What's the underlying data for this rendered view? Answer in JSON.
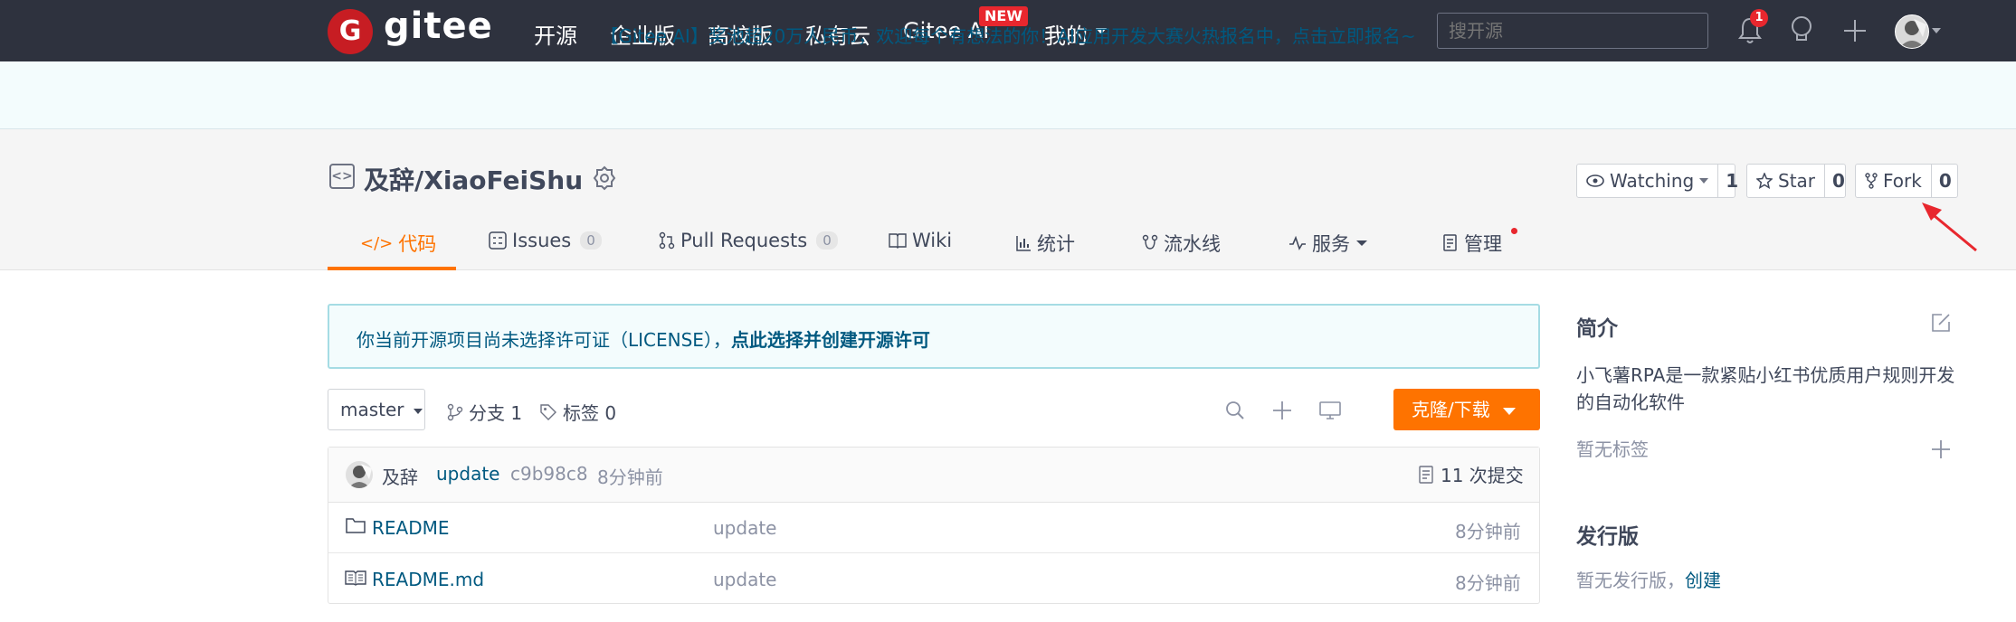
{
  "nav": {
    "brand": "gitee",
    "logo_letter": "G",
    "items": [
      "开源",
      "企业版",
      "高校版",
      "私有云",
      "Gitee AI",
      "我的"
    ],
    "new_badge": "NEW",
    "search_placeholder": "搜开源",
    "notification_count": "1"
  },
  "announcement": "【Gitee AI】奖池超20万人民币，欢迎每个有想法的你！AI应用开发大赛火热报名中，点击立即报名~",
  "repo": {
    "title": "及辞/XiaoFeiShu",
    "watch_label": "Watching",
    "watch_count": "1",
    "star_label": "Star",
    "star_count": "0",
    "fork_label": "Fork",
    "fork_count": "0"
  },
  "tabs": {
    "code": "代码",
    "issues": "Issues",
    "issues_count": "0",
    "pulls": "Pull Requests",
    "pulls_count": "0",
    "wiki": "Wiki",
    "stats": "统计",
    "pipeline": "流水线",
    "services": "服务",
    "manage": "管理"
  },
  "license": {
    "text": "你当前开源项目尚未选择许可证（LICENSE），",
    "link": "点此选择并创建开源许可"
  },
  "toolbar": {
    "branch": "master",
    "branches": "分支 1",
    "tags": "标签 0",
    "clone": "克隆/下载"
  },
  "commit": {
    "author": "及辞",
    "message": "update",
    "hash": "c9b98c8",
    "time": "8分钟前",
    "count": "11 次提交"
  },
  "files": [
    {
      "name": "README",
      "message": "update",
      "time": "8分钟前",
      "icon": "folder-icon"
    },
    {
      "name": "README.md",
      "message": "update",
      "time": "8分钟前",
      "icon": "book-icon"
    }
  ],
  "sidebar": {
    "intro_title": "简介",
    "intro_text": "小飞薯RPA是一款紧贴小红书优质用户规则开发的自动化软件",
    "no_tags": "暂无标签",
    "release_title": "发行版",
    "no_release": "暂无发行版，",
    "create": "创建"
  },
  "colors": {
    "nav_bg": "#2e323e",
    "brand_red": "#c71d23",
    "accent_orange": "#fe7300",
    "link_blue": "#005980",
    "arrow_red": "#e8272e"
  }
}
